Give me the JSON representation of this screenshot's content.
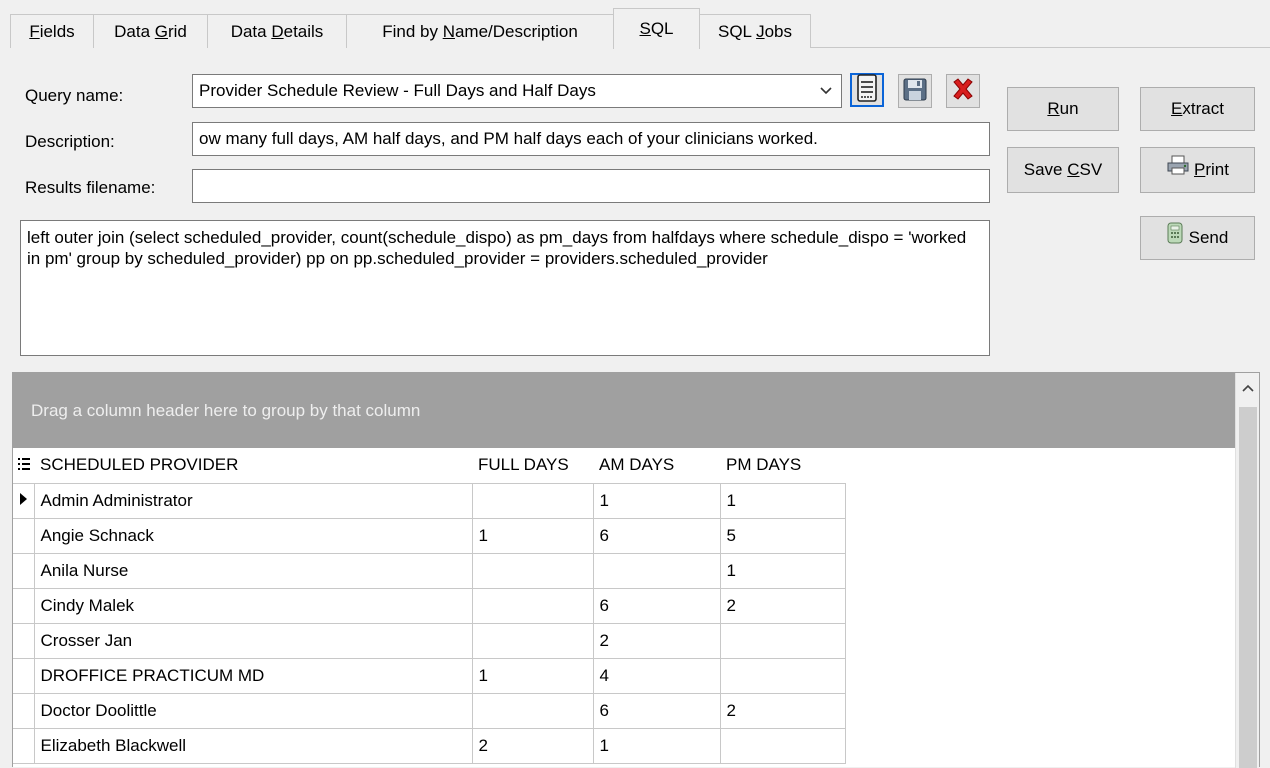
{
  "tabs": [
    {
      "label_pre": "",
      "label_u": "F",
      "label_post": "ields"
    },
    {
      "label_pre": "Data ",
      "label_u": "G",
      "label_post": "rid"
    },
    {
      "label_pre": "Data ",
      "label_u": "D",
      "label_post": "etails"
    },
    {
      "label_pre": "Find by ",
      "label_u": "N",
      "label_post": "ame/Description"
    },
    {
      "label_pre": "",
      "label_u": "S",
      "label_post": "QL"
    },
    {
      "label_pre": "SQL ",
      "label_u": "J",
      "label_post": "obs"
    }
  ],
  "form": {
    "query_name_label": "Query name:",
    "query_name_value": "Provider Schedule Review - Full Days and Half Days",
    "description_label": "Description:",
    "description_value": "ow many full days, AM half days, and PM half days each of your clinicians worked.",
    "results_filename_label": "Results filename:",
    "results_filename_value": "",
    "sql_text": "left outer join (select scheduled_provider, count(schedule_dispo) as pm_days from halfdays where schedule_dispo = 'worked in pm' group by scheduled_provider) pp on pp.scheduled_provider = providers.scheduled_provider"
  },
  "buttons": {
    "run": {
      "u": "R",
      "rest": "un"
    },
    "extract": {
      "u": "E",
      "rest": "xtract"
    },
    "save_csv": {
      "pre": "Save ",
      "u": "C",
      "rest": "SV"
    },
    "print": {
      "u": "P",
      "rest": "rint"
    },
    "send": {
      "label": "Send"
    }
  },
  "grid": {
    "group_hint": "Drag a column header here to group by that column",
    "columns": [
      "SCHEDULED PROVIDER",
      "FULL DAYS",
      "AM DAYS",
      "PM DAYS"
    ],
    "rows": [
      [
        "Admin Administrator",
        "",
        "1",
        "1"
      ],
      [
        "Angie Schnack",
        "1",
        "6",
        "5"
      ],
      [
        "Anila Nurse",
        "",
        "",
        "1"
      ],
      [
        "Cindy Malek",
        "",
        "6",
        "2"
      ],
      [
        "Crosser Jan",
        "",
        "2",
        ""
      ],
      [
        "DROFFICE PRACTICUM MD",
        "1",
        "4",
        ""
      ],
      [
        "Doctor Doolittle",
        "",
        "6",
        "2"
      ],
      [
        "Elizabeth Blackwell",
        "2",
        "1",
        ""
      ]
    ]
  },
  "icons": {
    "new_query": "document-list-icon",
    "save": "floppy-disk-icon",
    "delete": "red-x-icon",
    "print": "printer-icon",
    "send": "calculator-icon",
    "selected_row": "row-pointer-icon",
    "column_chooser": "column-list-icon",
    "scroll_up": "chevron-up-icon",
    "dropdown": "chevron-down-icon"
  }
}
